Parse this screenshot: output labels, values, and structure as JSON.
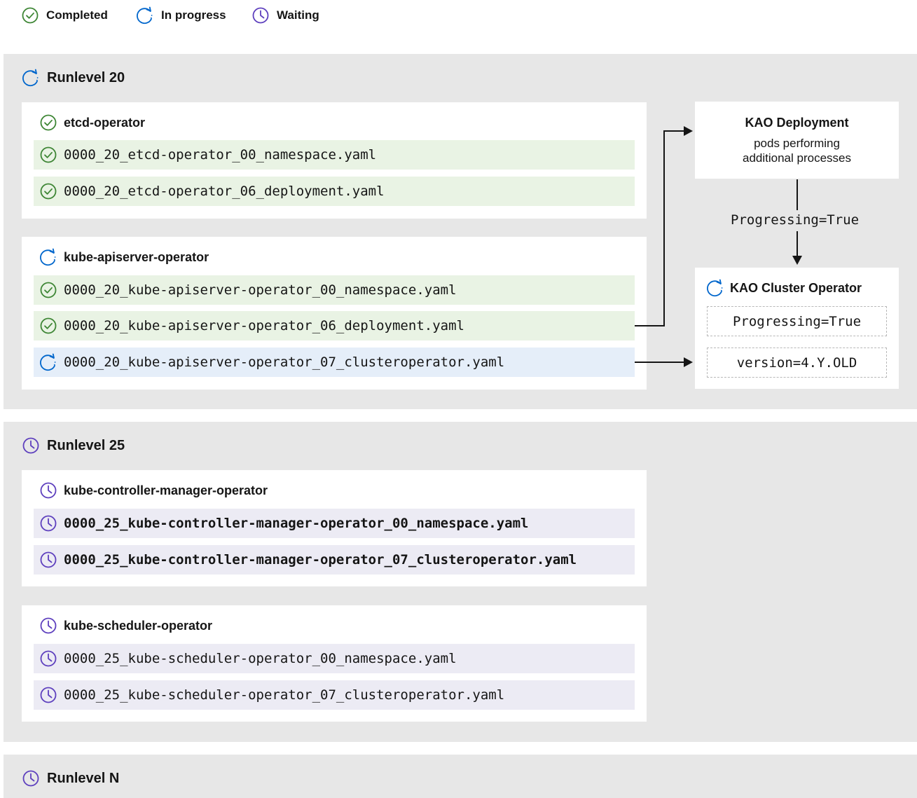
{
  "legend": {
    "completed": "Completed",
    "in_progress": "In progress",
    "waiting": "Waiting"
  },
  "colors": {
    "completed": "#3e8635",
    "in_progress": "#0066cc",
    "waiting": "#5e40be",
    "panel": "#e7e7e7"
  },
  "runlevels": [
    {
      "title": "Runlevel 20",
      "status": "in_progress",
      "operators": [
        {
          "name": "etcd-operator",
          "status": "completed",
          "files": [
            {
              "name": "0000_20_etcd-operator_00_namespace.yaml",
              "status": "completed"
            },
            {
              "name": "0000_20_etcd-operator_06_deployment.yaml",
              "status": "completed"
            }
          ]
        },
        {
          "name": "kube-apiserver-operator",
          "status": "in_progress",
          "files": [
            {
              "name": "0000_20_kube-apiserver-operator_00_namespace.yaml",
              "status": "completed"
            },
            {
              "name": "0000_20_kube-apiserver-operator_06_deployment.yaml",
              "status": "completed"
            },
            {
              "name": "0000_20_kube-apiserver-operator_07_clusteroperator.yaml",
              "status": "in_progress"
            }
          ]
        }
      ]
    },
    {
      "title": "Runlevel 25",
      "status": "waiting",
      "operators": [
        {
          "name": "kube-controller-manager-operator",
          "status": "waiting",
          "files": [
            {
              "name": "0000_25_kube-controller-manager-operator_00_namespace.yaml",
              "status": "waiting"
            },
            {
              "name": "0000_25_kube-controller-manager-operator_07_clusteroperator.yaml",
              "status": "waiting"
            }
          ]
        },
        {
          "name": "kube-scheduler-operator",
          "status": "waiting",
          "files": [
            {
              "name": "0000_25_kube-scheduler-operator_00_namespace.yaml",
              "status": "waiting"
            },
            {
              "name": "0000_25_kube-scheduler-operator_07_clusteroperator.yaml",
              "status": "waiting"
            }
          ]
        }
      ]
    },
    {
      "title": "Runlevel N",
      "status": "waiting"
    }
  ],
  "kao_deployment": {
    "title": "KAO Deployment",
    "subtitle_line1": "pods performing",
    "subtitle_line2": "additional processes"
  },
  "edge_label": "Progressing=True",
  "kao_cluster_operator": {
    "title": "KAO Cluster Operator",
    "status": "in_progress",
    "conditions": [
      "Progressing=True",
      "version=4.Y.OLD"
    ]
  }
}
